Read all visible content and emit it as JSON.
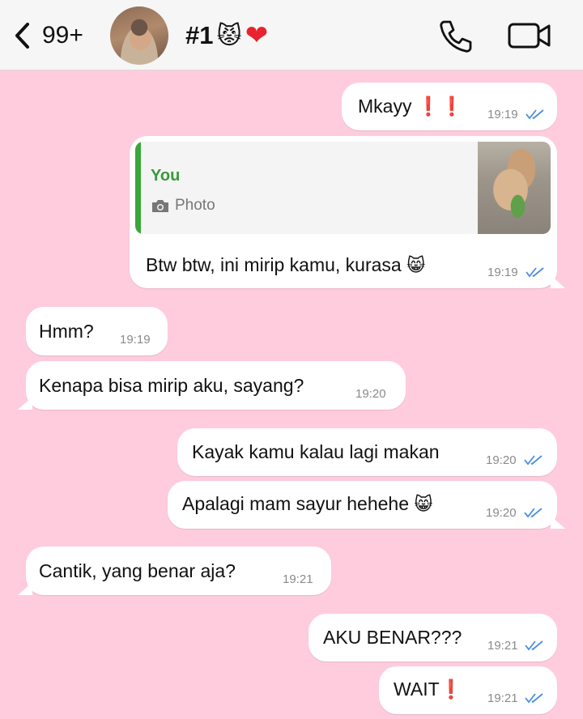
{
  "header": {
    "back_count": "99+",
    "contact_name": "#1",
    "name_emoji": "😾",
    "name_heart": "❤"
  },
  "messages": [
    {
      "id": "m1",
      "direction": "out",
      "text": "Mkayy",
      "suffix": "❗❗",
      "time": "19:19",
      "read": true
    },
    {
      "id": "m2",
      "direction": "out",
      "reply_to": {
        "author": "You",
        "type": "Photo"
      },
      "text": "Btw btw, ini mirip kamu, kurasa",
      "emoji": "😸",
      "time": "19:19",
      "read": true
    },
    {
      "id": "m3",
      "direction": "in",
      "text": "Hmm?",
      "time": "19:19"
    },
    {
      "id": "m4",
      "direction": "in",
      "text": "Kenapa bisa mirip aku, sayang?",
      "time": "19:20"
    },
    {
      "id": "m5",
      "direction": "out",
      "text": "Kayak kamu kalau lagi makan",
      "time": "19:20",
      "read": true
    },
    {
      "id": "m6",
      "direction": "out",
      "text": "Apalagi mam sayur hehehe",
      "emoji": "😸",
      "time": "19:20",
      "read": true
    },
    {
      "id": "m7",
      "direction": "in",
      "text": "Cantik, yang benar aja?",
      "time": "19:21"
    },
    {
      "id": "m8",
      "direction": "out",
      "text": "AKU BENAR???",
      "time": "19:21",
      "read": true
    },
    {
      "id": "m9",
      "direction": "out",
      "text": "WAIT",
      "suffix": "❗",
      "time": "19:21",
      "read": true
    }
  ],
  "colors": {
    "chat_background": "#ffccdd",
    "bubble": "#ffffff",
    "read_ticks": "#4a8ee0",
    "reply_bar": "#3aa63a"
  },
  "icons": [
    "chevron-left-icon",
    "phone-icon",
    "video-camera-icon",
    "camera-icon",
    "double-check-icon"
  ]
}
